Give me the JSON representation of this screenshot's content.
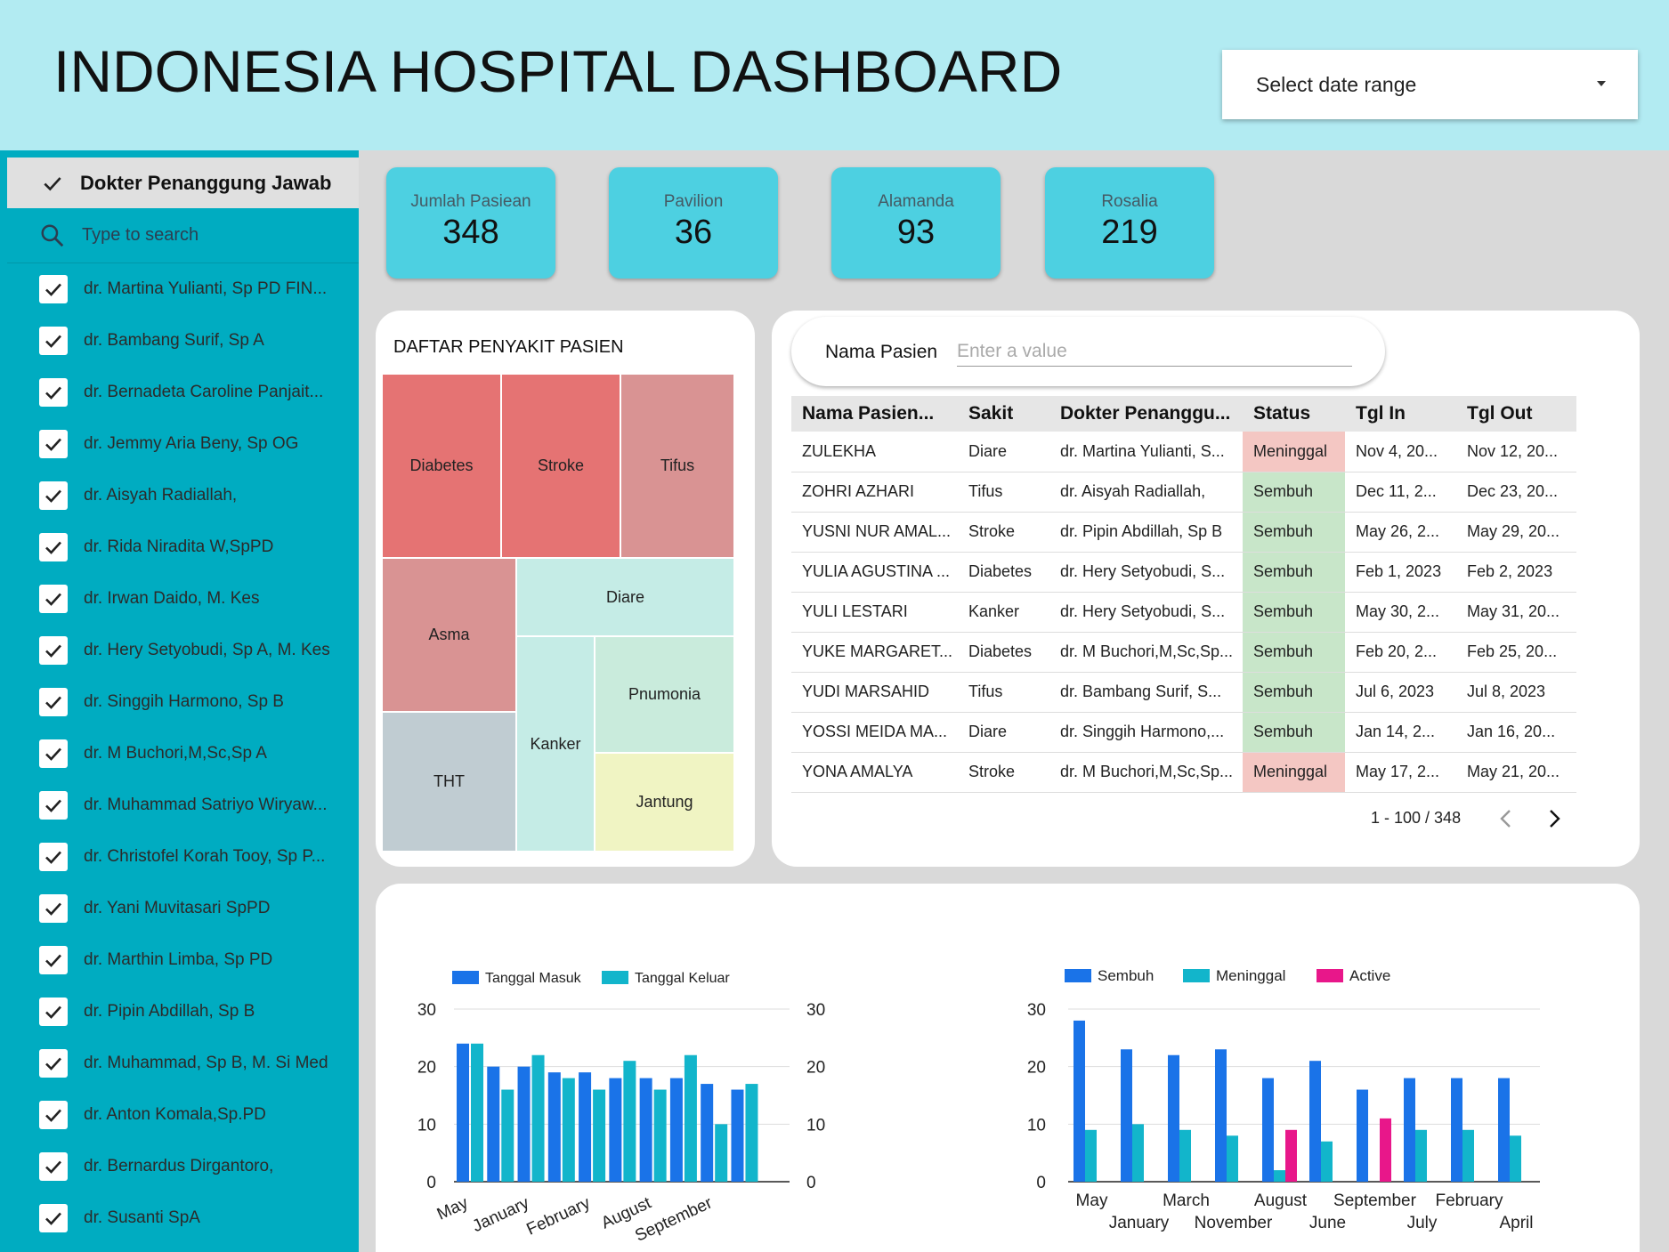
{
  "header": {
    "title": "INDONESIA HOSPITAL DASHBOARD",
    "date_range_label": "Select date range"
  },
  "sidebar": {
    "title": "Dokter Penanggung Jawab",
    "search_placeholder": "Type to search",
    "items": [
      "dr. Martina Yulianti, Sp PD FIN...",
      "dr. Bambang Surif, Sp A",
      "dr. Bernadeta Caroline Panjait...",
      "dr. Jemmy Aria Beny, Sp OG",
      "dr. Aisyah Radiallah,",
      "dr. Rida Niradita W,SpPD",
      "dr. Irwan Daido, M. Kes",
      "dr. Hery Setyobudi, Sp A, M. Kes",
      "dr. Singgih Harmono, Sp B",
      "dr. M Buchori,M,Sc,Sp A",
      "dr. Muhammad Satriyo Wiryaw...",
      "dr. Christofel Korah Tooy, Sp P...",
      "dr. Yani Muvitasari SpPD",
      "dr. Marthin Limba, Sp PD",
      "dr. Pipin Abdillah, Sp B",
      "dr. Muhammad, Sp B, M. Si Med",
      "dr. Anton Komala,Sp.PD",
      "dr. Bernardus Dirgantoro,",
      "dr. Susanti SpA"
    ]
  },
  "kpis": [
    {
      "label": "Jumlah Pasiean",
      "value": "348"
    },
    {
      "label": "Pavilion",
      "value": "36"
    },
    {
      "label": "Alamanda",
      "value": "93"
    },
    {
      "label": "Rosalia",
      "value": "219"
    }
  ],
  "treemap": {
    "title": "DAFTAR PENYAKIT PASIEN",
    "labels": [
      "Diabetes",
      "Stroke",
      "Tifus",
      "Asma",
      "Diare",
      "Pnumonia",
      "Kanker",
      "Jantung",
      "THT"
    ],
    "colors": {
      "Diabetes": "#e57373",
      "Stroke": "#e57373",
      "Tifus": "#d99393",
      "Asma": "#d99393",
      "Diare": "#c5ece6",
      "Pnumonia": "#c9ebdc",
      "Kanker": "#c5ece6",
      "Jantung": "#f0f4c3",
      "THT": "#c0ccd2"
    }
  },
  "patient_filter": {
    "label": "Nama Pasien",
    "placeholder": "Enter a value"
  },
  "table": {
    "headers": [
      "Nama Pasien...",
      "Sakit",
      "Dokter Penanggu...",
      "Status",
      "Tgl In",
      "Tgl Out"
    ],
    "rows": [
      [
        "ZULEKHA",
        "Diare",
        "dr. Martina Yulianti, S...",
        "Meninggal",
        "Nov 4, 20...",
        "Nov 12, 20..."
      ],
      [
        "ZOHRI AZHARI",
        "Tifus",
        "dr. Aisyah Radiallah,",
        "Sembuh",
        "Dec 11, 2...",
        "Dec 23, 20..."
      ],
      [
        "YUSNI NUR AMAL...",
        "Stroke",
        "dr. Pipin Abdillah, Sp B",
        "Sembuh",
        "May 26, 2...",
        "May 29, 20..."
      ],
      [
        "YULIA AGUSTINA ...",
        "Diabetes",
        "dr. Hery Setyobudi, S...",
        "Sembuh",
        "Feb 1, 2023",
        "Feb 2, 2023"
      ],
      [
        "YULI LESTARI",
        "Kanker",
        "dr. Hery Setyobudi, S...",
        "Sembuh",
        "May 30, 2...",
        "May 31, 20..."
      ],
      [
        "YUKE MARGARET...",
        "Diabetes",
        "dr. M Buchori,M,Sc,Sp...",
        "Sembuh",
        "Feb 20, 2...",
        "Feb 25, 20..."
      ],
      [
        "YUDI MARSAHID",
        "Tifus",
        "dr. Bambang Surif, S...",
        "Sembuh",
        "Jul 6, 2023",
        "Jul 8, 2023"
      ],
      [
        "YOSSI MEIDA MA...",
        "Diare",
        "dr. Singgih Harmono,...",
        "Sembuh",
        "Jan 14, 2...",
        "Jan 16, 20..."
      ],
      [
        "YONA AMALYA",
        "Stroke",
        "dr. M Buchori,M,Sc,Sp...",
        "Meninggal",
        "May 17, 2...",
        "May 21, 20..."
      ]
    ],
    "pager": "1 - 100 / 348",
    "status_colors": {
      "Meninggal": "#f4c7c3",
      "Sembuh": "#c8e6c9"
    }
  },
  "chart_data": [
    {
      "type": "bar",
      "legend": [
        "Tanggal Masuk",
        "Tanggal Keluar"
      ],
      "categories": [
        "May",
        "",
        "January",
        "",
        "February",
        "",
        "August",
        "",
        "September",
        "",
        ""
      ],
      "series": [
        {
          "name": "Tanggal Masuk",
          "color": "#1a73e8",
          "values": [
            24,
            20,
            20,
            19,
            19,
            18,
            18,
            18,
            17,
            16,
            0
          ]
        },
        {
          "name": "Tanggal Keluar",
          "color": "#12b5cb",
          "values": [
            24,
            16,
            22,
            18,
            16,
            21,
            16,
            22,
            10,
            17,
            0
          ]
        }
      ],
      "ylim": [
        0,
        30
      ],
      "yticks": [
        0,
        10,
        20,
        30
      ],
      "legend_position": "top-left"
    },
    {
      "type": "bar",
      "legend": [
        "Sembuh",
        "Meninggal",
        "Active"
      ],
      "categories": [
        "May",
        "January",
        "March",
        "November",
        "August",
        "June",
        "September",
        "July",
        "February",
        "April"
      ],
      "series": [
        {
          "name": "Sembuh",
          "color": "#1a73e8",
          "values": [
            28,
            23,
            22,
            23,
            18,
            21,
            16,
            18,
            18,
            18
          ]
        },
        {
          "name": "Meninggal",
          "color": "#12b5cb",
          "values": [
            9,
            10,
            9,
            8,
            2,
            7,
            0,
            9,
            9,
            8
          ]
        },
        {
          "name": "Active",
          "color": "#e8178a",
          "values": [
            0,
            0,
            0,
            0,
            9,
            0,
            11,
            0,
            0,
            0
          ]
        }
      ],
      "ylim": [
        0,
        30
      ],
      "yticks": [
        0,
        10,
        20,
        30
      ],
      "legend_position": "top-left"
    }
  ]
}
